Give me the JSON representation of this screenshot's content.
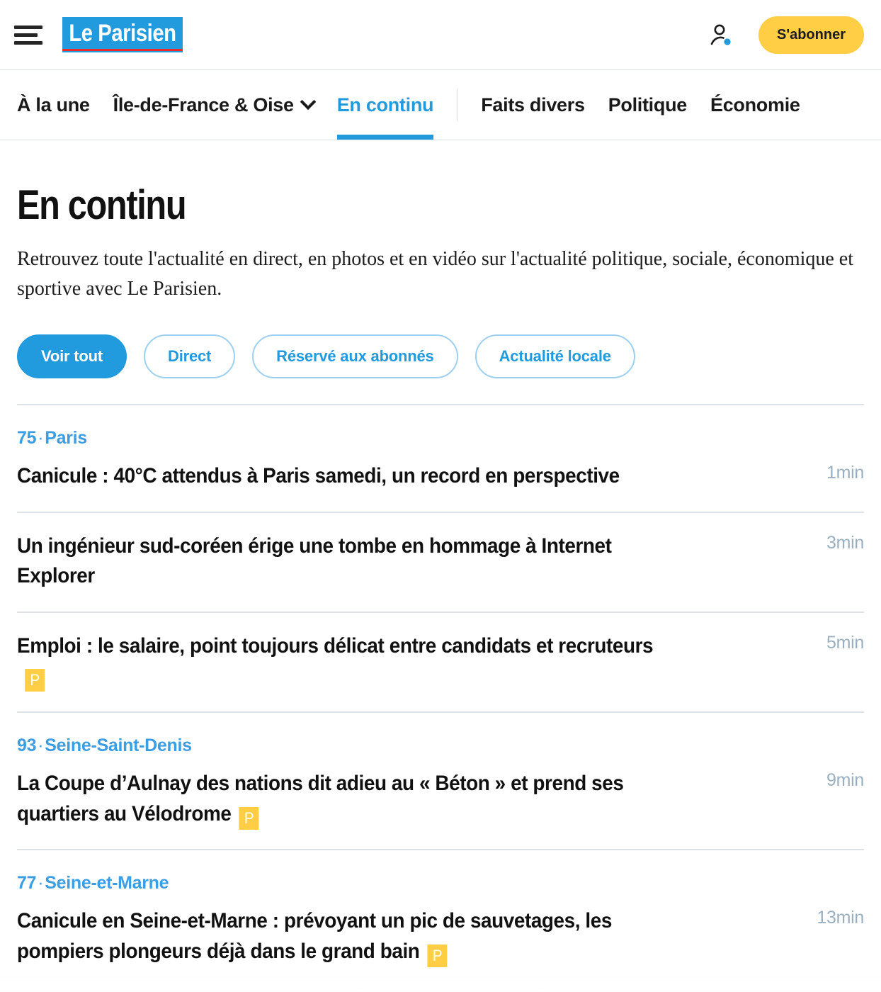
{
  "header": {
    "menu_icon": "hamburger-menu-icon",
    "logo_text": "Le Parisien",
    "account_icon": "account-person-icon",
    "subscribe_label": "S'abonner"
  },
  "nav": {
    "items": [
      {
        "label": "À la une",
        "active": false,
        "has_chevron": false
      },
      {
        "label": "Île-de-France & Oise",
        "active": false,
        "has_chevron": true
      },
      {
        "label": "En continu",
        "active": true,
        "has_chevron": false
      },
      {
        "label": "Faits divers",
        "active": false,
        "has_chevron": false
      },
      {
        "label": "Politique",
        "active": false,
        "has_chevron": false
      },
      {
        "label": "Économie",
        "active": false,
        "has_chevron": false
      }
    ]
  },
  "page": {
    "title": "En continu",
    "description": "Retrouvez toute l'actualité en direct, en photos et en vidéo sur l'actualité politique, sociale, économique et sportive avec Le Parisien."
  },
  "filters": [
    {
      "label": "Voir tout",
      "active": true
    },
    {
      "label": "Direct",
      "active": false
    },
    {
      "label": "Réservé aux abonnés",
      "active": false
    },
    {
      "label": "Actualité locale",
      "active": false
    }
  ],
  "groups": [
    {
      "dept_code": "75",
      "dept_name": "Paris",
      "articles": [
        {
          "title": "Canicule : 40°C attendus à Paris samedi, un record en perspective",
          "time": "1min",
          "premium": false
        },
        {
          "title": "Un ingénieur sud-coréen érige une tombe en hommage à Internet Explorer",
          "time": "3min",
          "premium": false
        },
        {
          "title": "Emploi : le salaire, point toujours délicat entre candidats et recruteurs",
          "time": "5min",
          "premium": true
        }
      ]
    },
    {
      "dept_code": "93",
      "dept_name": "Seine-Saint-Denis",
      "articles": [
        {
          "title": "La Coupe d’Aulnay des nations dit adieu au « Béton » et prend ses quartiers au Vélodrome",
          "time": "9min",
          "premium": true
        }
      ]
    },
    {
      "dept_code": "77",
      "dept_name": "Seine-et-Marne",
      "articles": [
        {
          "title": "Canicule en Seine-et-Marne : prévoyant un pic de sauvetages, les pompiers plongeurs déjà dans le grand bain",
          "time": "13min",
          "premium": true
        }
      ]
    }
  ],
  "badges": {
    "premium_letter": "P"
  },
  "colors": {
    "brand_blue": "#229ade",
    "dept_blue": "#3b9ee2",
    "subscribe_yellow": "#ffce45",
    "premium_yellow": "#ffce45",
    "logo_red": "#ee2b2b",
    "time_gray": "#9ab0bf",
    "divider_gray": "#dde2e7"
  }
}
